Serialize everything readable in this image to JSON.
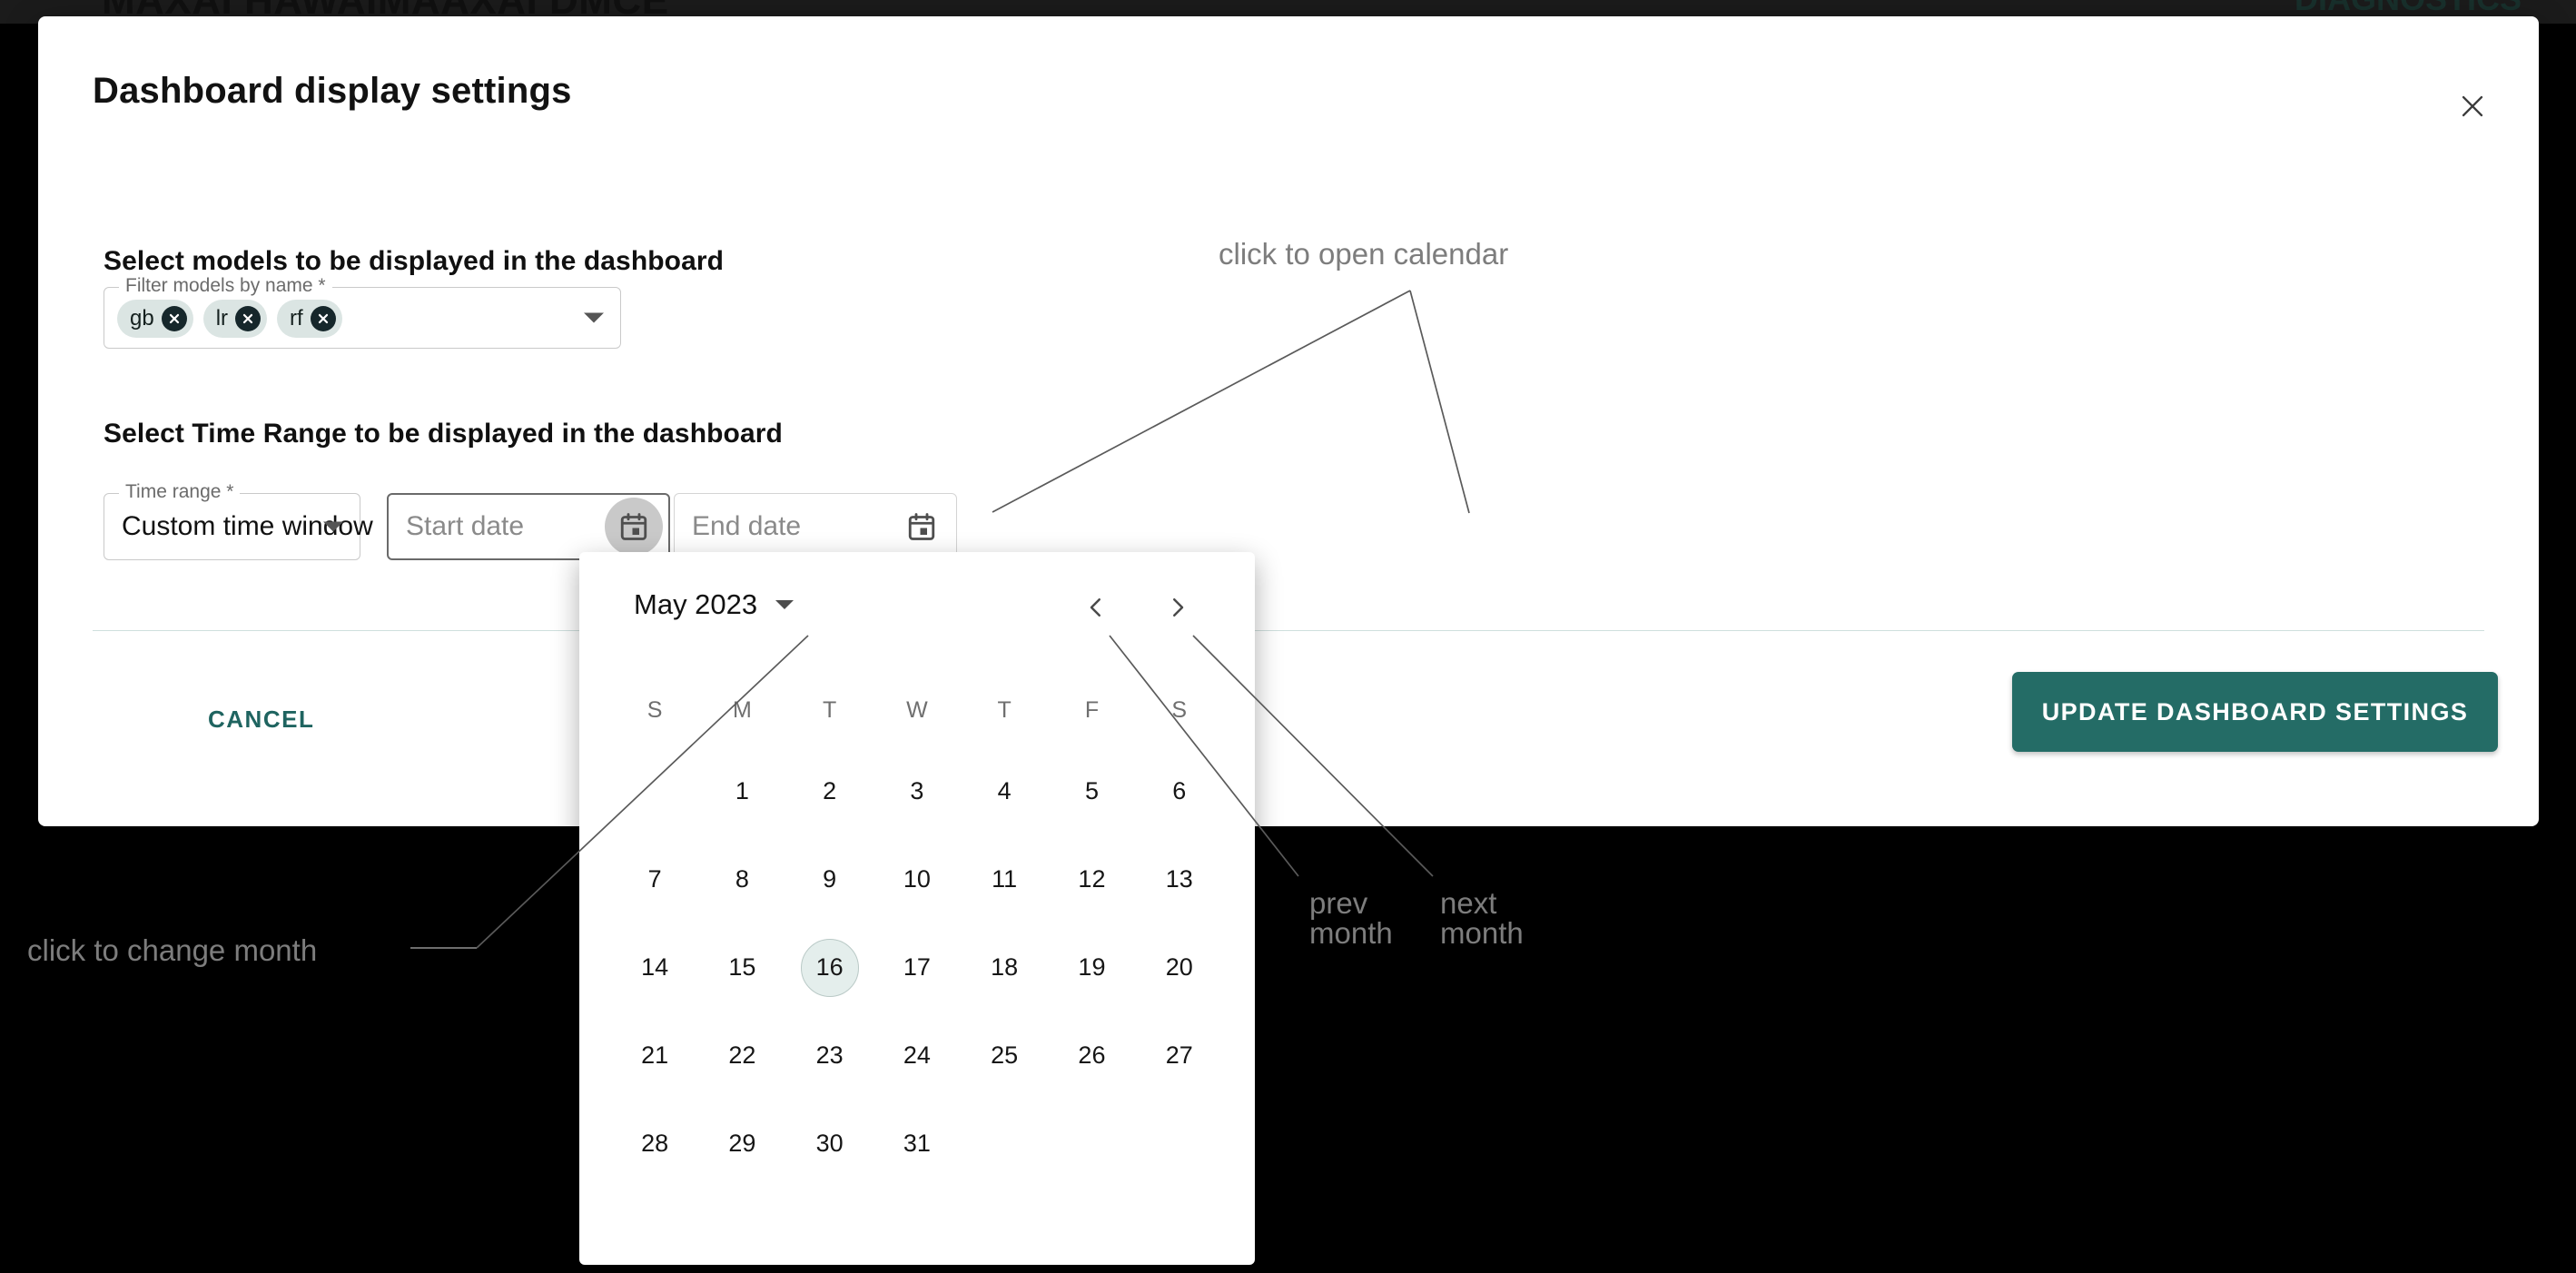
{
  "background": {
    "title_fragment": "MAXAI HAWAIMAAXAI DMCE",
    "right_fragment": "DIAGNOSTICS"
  },
  "modal": {
    "title": "Dashboard display settings",
    "close_icon": "close-icon",
    "models_section": {
      "heading": "Select models to be displayed in the dashboard",
      "field_legend": "Filter models by name",
      "required_marker": "*",
      "chips": [
        {
          "label": "gb",
          "delete_icon": "cancel-circle-icon"
        },
        {
          "label": "lr",
          "delete_icon": "cancel-circle-icon"
        },
        {
          "label": "rf",
          "delete_icon": "cancel-circle-icon"
        }
      ],
      "dropdown_icon": "chevron-down-icon"
    },
    "timerange_section": {
      "heading": "Select Time Range to be displayed in the dashboard",
      "time_range_legend": "Time range",
      "time_range_required": "*",
      "time_range_value": "Custom time window",
      "time_range_dropdown_icon": "chevron-down-icon",
      "start_date_placeholder": "Start date",
      "start_date_value": "",
      "start_date_icon": "calendar-icon",
      "end_date_placeholder": "End date",
      "end_date_value": "",
      "end_date_icon": "calendar-icon"
    },
    "footer": {
      "cancel_label": "CANCEL",
      "update_label": "UPDATE DASHBOARD SETTINGS"
    }
  },
  "calendar": {
    "month_label": "May 2023",
    "month_dropdown_icon": "chevron-down-icon",
    "prev_icon": "chevron-left-icon",
    "next_icon": "chevron-right-icon",
    "weekdays": [
      "S",
      "M",
      "T",
      "W",
      "T",
      "F",
      "S"
    ],
    "leading_blanks": 1,
    "days": [
      1,
      2,
      3,
      4,
      5,
      6,
      7,
      8,
      9,
      10,
      11,
      12,
      13,
      14,
      15,
      16,
      17,
      18,
      19,
      20,
      21,
      22,
      23,
      24,
      25,
      26,
      27,
      28,
      29,
      30,
      31
    ],
    "today": 16,
    "selected": null
  },
  "annotations": {
    "open_calendar": "click to open calendar",
    "change_month": "click to change month",
    "prev_month": "prev\nmonth",
    "next_month": "next\nmonth"
  },
  "colors": {
    "brand_teal": "#246c66",
    "chip_bg": "#dbe5e3",
    "today_bg": "#e4eeec",
    "annotation_gray": "#7d7d7d",
    "page_black": "#000000"
  }
}
